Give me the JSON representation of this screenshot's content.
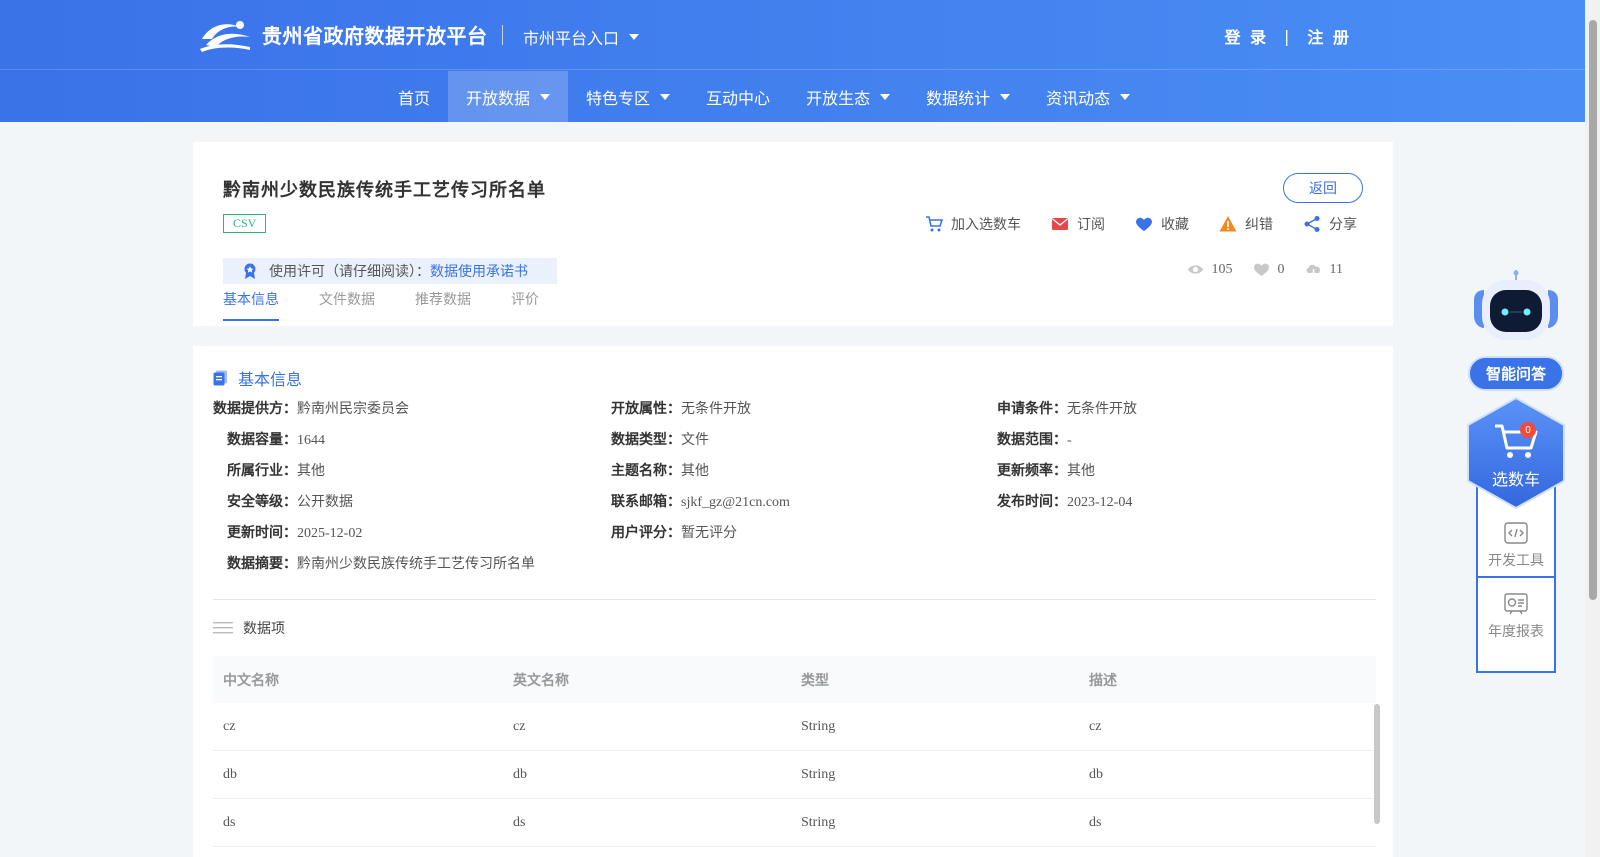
{
  "header": {
    "site_title": "贵州省政府数据开放平台",
    "city_entry": "市州平台入口",
    "login": "登 录",
    "auth_sep": "|",
    "register": "注 册"
  },
  "nav": {
    "items": [
      {
        "label": "首页",
        "dropdown": false
      },
      {
        "label": "开放数据",
        "dropdown": true,
        "active": true
      },
      {
        "label": "特色专区",
        "dropdown": true
      },
      {
        "label": "互动中心",
        "dropdown": false
      },
      {
        "label": "开放生态",
        "dropdown": true
      },
      {
        "label": "数据统计",
        "dropdown": true
      },
      {
        "label": "资讯动态",
        "dropdown": true
      }
    ]
  },
  "dataset": {
    "title": "黔南州少数民族传统手工艺传习所名单",
    "format": "CSV",
    "license_label": "使用许可（请仔细阅读）：",
    "license_link": "数据使用承诺书",
    "back": "返回",
    "actions": {
      "cart": "加入选数车",
      "subscribe": "订阅",
      "favorite": "收藏",
      "report": "纠错",
      "share": "分享"
    },
    "stats": {
      "views": "105",
      "likes": "0",
      "downloads": "11"
    },
    "tabs": [
      "基本信息",
      "文件数据",
      "推荐数据",
      "评价"
    ]
  },
  "basic_info": {
    "section_title": "基本信息",
    "rows": [
      [
        {
          "k": "数据提供方：",
          "v": "黔南州民宗委员会"
        },
        {
          "k": "开放属性：",
          "v": "无条件开放"
        },
        {
          "k": "申请条件：",
          "v": "无条件开放"
        }
      ],
      [
        {
          "k": "数据容量：",
          "v": "1644"
        },
        {
          "k": "数据类型：",
          "v": "文件"
        },
        {
          "k": "数据范围：",
          "v": "-"
        }
      ],
      [
        {
          "k": "所属行业：",
          "v": "其他"
        },
        {
          "k": "主题名称：",
          "v": "其他"
        },
        {
          "k": "更新频率：",
          "v": "其他"
        }
      ],
      [
        {
          "k": "安全等级：",
          "v": "公开数据"
        },
        {
          "k": "联系邮箱：",
          "v": "sjkf_gz@21cn.com"
        },
        {
          "k": "发布时间：",
          "v": "2023-12-04"
        }
      ],
      [
        {
          "k": "更新时间：",
          "v": "2025-12-02"
        },
        {
          "k": "用户评分：",
          "v": "暂无评分"
        }
      ],
      [
        {
          "k": "数据摘要：",
          "v": "黔南州少数民族传统手工艺传习所名单"
        }
      ]
    ]
  },
  "data_items": {
    "title": "数据项",
    "headers": [
      "中文名称",
      "英文名称",
      "类型",
      "描述"
    ],
    "rows": [
      [
        "cz",
        "cz",
        "String",
        "cz"
      ],
      [
        "db",
        "db",
        "String",
        "db"
      ],
      [
        "ds",
        "ds",
        "String",
        "ds"
      ]
    ]
  },
  "sidebar_widgets": {
    "ai": "智能问答",
    "cart": "选数车",
    "cart_count": "0",
    "dev_tools": "开发工具",
    "annual_report": "年度报表"
  },
  "colors": {
    "primary": "#3a72e8",
    "csv_green": "#2ab37a",
    "badge_red": "#f24a3b"
  }
}
